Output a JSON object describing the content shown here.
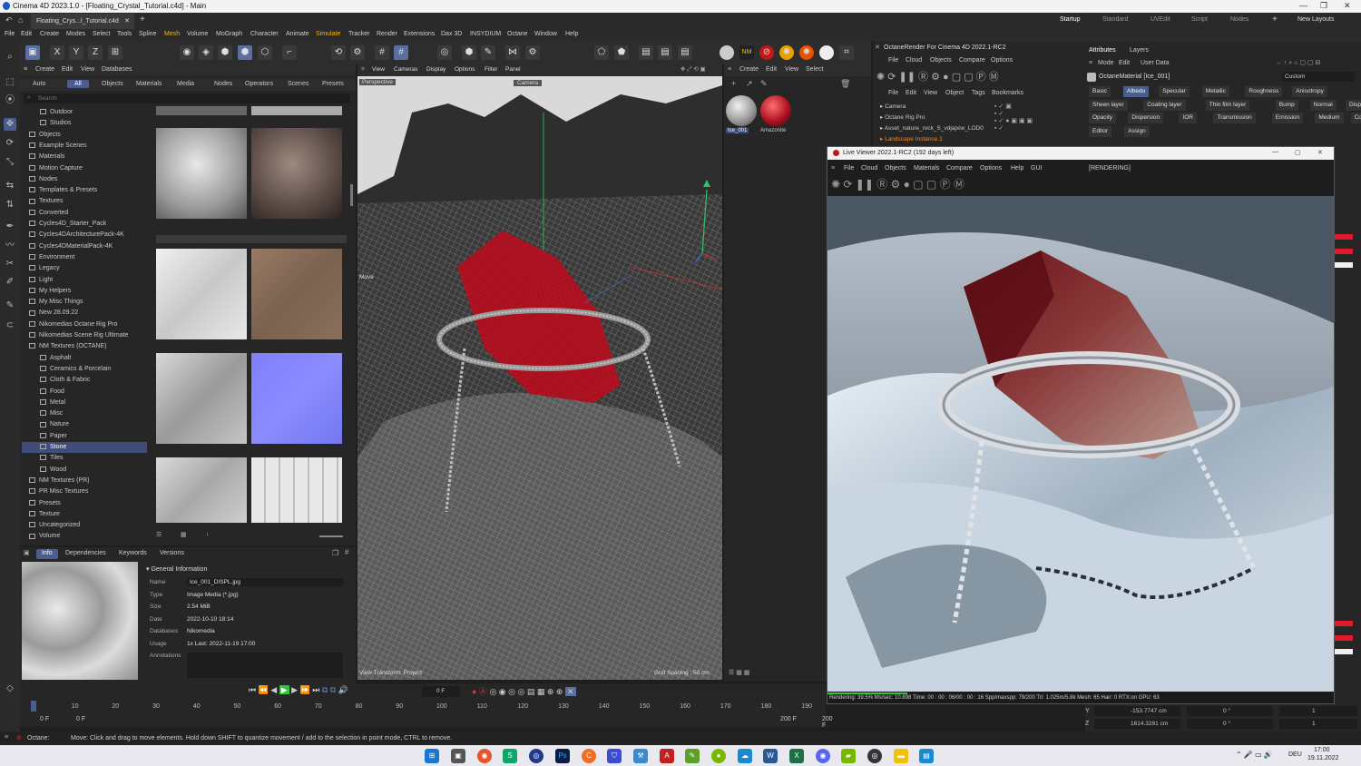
{
  "window": {
    "title": "Cinema 4D 2023.1.0 - [Floating_Crystal_Tutorial.c4d] - Main",
    "doc_tab": "Floating_Crys...l_Tutorial.c4d",
    "layouts": [
      "Startup",
      "Standard",
      "UVEdit",
      "Script",
      "Nodes"
    ],
    "new_layouts": "New Layouts"
  },
  "menu": [
    "File",
    "Edit",
    "Create",
    "Modes",
    "Select",
    "Tools",
    "Spline",
    "Mesh",
    "Volume",
    "MoGraph",
    "Character",
    "Animate",
    "Simulate",
    "Tracker",
    "Render",
    "Extensions",
    "Dax 3D",
    "INSYDIUM",
    "Octane",
    "Window",
    "Help"
  ],
  "asset_browser": {
    "menu": [
      "Create",
      "Edit",
      "View",
      "Databases"
    ],
    "filter_tabs": [
      "Auto",
      "All",
      "Objects",
      "Materials",
      "Media",
      "Nodes",
      "Operators",
      "Scenes",
      "Presets"
    ],
    "search_placeholder": "Search",
    "tree": [
      {
        "label": "Outdoor",
        "indent": 2
      },
      {
        "label": "Studios",
        "indent": 2
      },
      {
        "label": "Objects",
        "indent": 1
      },
      {
        "label": "Example Scenes",
        "indent": 1
      },
      {
        "label": "Materials",
        "indent": 1
      },
      {
        "label": "Motion Capture",
        "indent": 1
      },
      {
        "label": "Nodes",
        "indent": 1
      },
      {
        "label": "Templates & Presets",
        "indent": 1
      },
      {
        "label": "Textures",
        "indent": 1
      },
      {
        "label": "Converted",
        "indent": 1
      },
      {
        "label": "Cycles4D_Starter_Pack",
        "indent": 1
      },
      {
        "label": "Cycles4DArchitecturePack-4K",
        "indent": 1
      },
      {
        "label": "Cycles4DMaterialPack-4K",
        "indent": 1
      },
      {
        "label": "Environment",
        "indent": 1
      },
      {
        "label": "Legacy",
        "indent": 1
      },
      {
        "label": "Light",
        "indent": 1
      },
      {
        "label": "My Helpers",
        "indent": 1
      },
      {
        "label": "My Misc Things",
        "indent": 1
      },
      {
        "label": "New 28.09.22",
        "indent": 1
      },
      {
        "label": "Nikomedias Octane Rig Pro",
        "indent": 1
      },
      {
        "label": "Nikomedias Scene Rig Ultimate",
        "indent": 1
      },
      {
        "label": "NM Textures (OCTANE)",
        "indent": 1
      },
      {
        "label": "Asphalt",
        "indent": 2
      },
      {
        "label": "Ceramics & Porcelain",
        "indent": 2
      },
      {
        "label": "Cloth & Fabric",
        "indent": 2
      },
      {
        "label": "Food",
        "indent": 2
      },
      {
        "label": "Metal",
        "indent": 2
      },
      {
        "label": "Misc",
        "indent": 2
      },
      {
        "label": "Nature",
        "indent": 2
      },
      {
        "label": "Paper",
        "indent": 2
      },
      {
        "label": "Stone",
        "indent": 2,
        "selected": true
      },
      {
        "label": "Tiles",
        "indent": 2
      },
      {
        "label": "Wood",
        "indent": 2
      },
      {
        "label": "NM Textures (PR)",
        "indent": 1
      },
      {
        "label": "PR Misc Textures",
        "indent": 1
      },
      {
        "label": "Presets",
        "indent": 1
      },
      {
        "label": "Texture",
        "indent": 1
      },
      {
        "label": "Uncategorized",
        "indent": 1
      },
      {
        "label": "Volume",
        "indent": 1
      }
    ]
  },
  "info_panel": {
    "tabs": [
      "Info",
      "Dependencies",
      "Keywords",
      "Versions"
    ],
    "section": "General Information",
    "fields": [
      {
        "key": "Name",
        "value": "Ice_001_DISPL.jpg"
      },
      {
        "key": "Type",
        "value": "Image Media (*.jpg)"
      },
      {
        "key": "Size",
        "value": "2.54 MiB"
      },
      {
        "key": "Date",
        "value": "2022-10-10 18:14"
      },
      {
        "key": "Databases",
        "value": "Nikomedia"
      },
      {
        "key": "Usage",
        "value": "1x Last: 2022-11-19 17:00"
      },
      {
        "key": "Annotations",
        "value": ""
      }
    ]
  },
  "viewport": {
    "menu": [
      "View",
      "Cameras",
      "Display",
      "Options",
      "Filter",
      "Panel"
    ],
    "label": "Perspective",
    "camera": "Camera",
    "move": "Move",
    "footer_left": "View Transform: Project",
    "grid_spacing": "Grid Spacing : 50 cm"
  },
  "object_manager": {
    "menu": [
      "Create",
      "Edit",
      "View",
      "Select"
    ],
    "materials": [
      "Ice_001",
      "Amazonite"
    ]
  },
  "octane_panel": {
    "title": "OctaneRender For Cinema 4D 2022.1-RC2",
    "menu": [
      "File",
      "Cloud",
      "Objects",
      "Compare",
      "Options"
    ],
    "menu2": [
      "File",
      "Edit",
      "View",
      "Object",
      "Tags",
      "Bookmarks"
    ],
    "objects": [
      "Camera",
      "Octane Rig Pro",
      "Asset_nature_rock_S_vdjajxiw_LOD0",
      "Landscape Instance.1"
    ]
  },
  "attributes": {
    "tabs": [
      "Attributes",
      "Layers"
    ],
    "menu": [
      "Mode",
      "Edit",
      "User Data"
    ],
    "material": "OctaneMaterial [Ice_001]",
    "preset": "Custom",
    "channel_tabs_row1": [
      "Basic",
      "Albedo",
      "Specular",
      "Metallic",
      "Roughness",
      "Anisotropy"
    ],
    "channel_tabs_row2": [
      "Sheen layer",
      "Coating layer",
      "Thin film layer",
      "Bump",
      "Normal",
      "Displacement"
    ],
    "channel_tabs_row3": [
      "Opacity",
      "Dispersion",
      "IOR",
      "Transmission",
      "Emission",
      "Medium",
      "Common"
    ],
    "channel_tabs_row4": [
      "Editor",
      "Assign"
    ],
    "active_tab": "Albedo"
  },
  "live_viewer": {
    "title": "Live Viewer 2022.1-RC2 (192 days left)",
    "menu": [
      "File",
      "Cloud",
      "Objects",
      "Materials",
      "Compare",
      "Options",
      "Help",
      "GUI"
    ],
    "state": "[RENDERING]",
    "status": "Rendering: 39.5%   Ms/sec: 10.898   Time: 00 : 00 : 06/00 : 00 : 16   Spp/maxspp: 79/200   Tri: 1.025m/5.8k   Mesh: 65   Hair: 0   RTX:on   GPU:  63",
    "progress": 0.395
  },
  "coordinates": {
    "y_label": "Y",
    "z_label": "Z",
    "rows": [
      {
        "pos": "-153.7747 cm",
        "rot": "0 °",
        "scale": "1"
      },
      {
        "pos": "1614.3281 cm",
        "rot": "0 °",
        "scale": "1"
      }
    ]
  },
  "timeline": {
    "ticks": [
      "0",
      "10",
      "20",
      "30",
      "40",
      "50",
      "60",
      "70",
      "80",
      "90",
      "100",
      "110",
      "120",
      "130",
      "140",
      "150",
      "160",
      "170",
      "180",
      "190"
    ],
    "current_frame": "0 F",
    "start": "0 F",
    "start2": "0 F",
    "end": "200 F",
    "end2": "200 F"
  },
  "status_bar": {
    "engine": "Octane:",
    "message": "Move: Click and drag to move elements. Hold down SHIFT to quantize movement / add to the selection in point mode, CTRL to remove."
  },
  "taskbar": {
    "lang": "DEU",
    "time": "17:00",
    "date": "19.11.2022"
  },
  "colors": {
    "accent": "#4a5d8f",
    "crystal": "#b01222",
    "progress": "#2fc43a"
  }
}
